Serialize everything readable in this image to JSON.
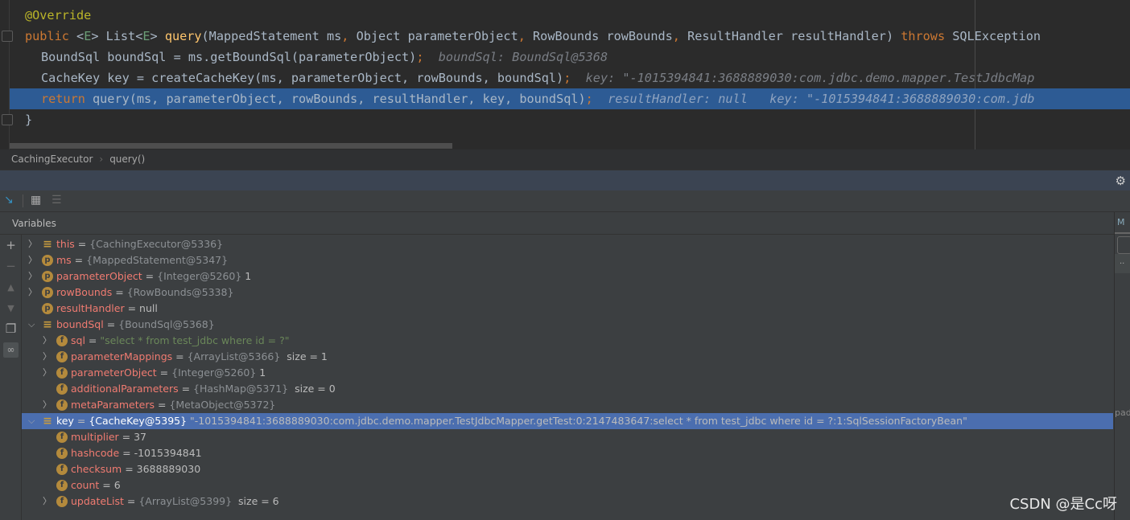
{
  "editor": {
    "lines": [
      {
        "annotation": "@Override"
      },
      {
        "code": [
          "public",
          "<",
          "E",
          "> List<",
          "E",
          "> ",
          "query",
          "(MappedStatement ms",
          ", ",
          "Object parameterObject",
          ", ",
          "RowBounds rowBounds",
          ", ",
          "ResultHandler resultHandler) ",
          "throws",
          " SQLException"
        ]
      },
      {
        "code": "BoundSql boundSql = ms.getBoundSql(parameterObject)",
        "hint": "boundSql: BoundSql@5368"
      },
      {
        "code": "CacheKey key = createCacheKey(ms, parameterObject, rowBounds, boundSql)",
        "hint": "key: \"-1015394841:3688889030:com.jdbc.demo.mapper.TestJdbcMap"
      },
      {
        "keyword": "return",
        "code": " query(ms, parameterObject, rowBounds, resultHandler, key, boundSql)",
        "hint": "resultHandler: null   key: \"-1015394841:3688889030:com.jdb"
      },
      {
        "code": "}"
      }
    ]
  },
  "breadcrumb": [
    "CachingExecutor",
    "query()"
  ],
  "variables": {
    "title": "Variables",
    "rows": [
      {
        "level": 0,
        "expand": ">",
        "icon": "list",
        "name": "this",
        "type": "{CachingExecutor@5336}",
        "value": ""
      },
      {
        "level": 0,
        "expand": ">",
        "icon": "p",
        "name": "ms",
        "type": "{MappedStatement@5347}",
        "value": ""
      },
      {
        "level": 0,
        "expand": ">",
        "icon": "p",
        "name": "parameterObject",
        "type": "{Integer@5260}",
        "value": " 1"
      },
      {
        "level": 0,
        "expand": ">",
        "icon": "p",
        "name": "rowBounds",
        "type": "{RowBounds@5338}",
        "value": ""
      },
      {
        "level": 0,
        "expand": "",
        "icon": "p",
        "name": "resultHandler",
        "type": "",
        "value": "null"
      },
      {
        "level": 0,
        "expand": "v",
        "icon": "list",
        "name": "boundSql",
        "type": "{BoundSql@5368}",
        "value": ""
      },
      {
        "level": 1,
        "expand": ">",
        "icon": "f",
        "name": "sql",
        "type": "",
        "str": "\"select * from test_jdbc where id = ?\""
      },
      {
        "level": 1,
        "expand": ">",
        "icon": "f",
        "name": "parameterMappings",
        "type": "{ArrayList@5366}",
        "value": "  size = 1"
      },
      {
        "level": 1,
        "expand": ">",
        "icon": "f",
        "name": "parameterObject",
        "type": "{Integer@5260}",
        "value": " 1"
      },
      {
        "level": 1,
        "expand": "",
        "icon": "f",
        "name": "additionalParameters",
        "type": "{HashMap@5371}",
        "value": "  size = 0"
      },
      {
        "level": 1,
        "expand": ">",
        "icon": "f",
        "name": "metaParameters",
        "type": "{MetaObject@5372}",
        "value": ""
      },
      {
        "level": 0,
        "expand": "v",
        "icon": "list",
        "name": "key",
        "type": "{CacheKey@5395}",
        "value": " \"-1015394841:3688889030:com.jdbc.demo.mapper.TestJdbcMapper.getTest:0:2147483647:select * from test_jdbc where id = ?:1:SqlSessionFactoryBean\"",
        "selected": true
      },
      {
        "level": 1,
        "expand": "",
        "icon": "f",
        "name": "multiplier",
        "type": "",
        "value": "37"
      },
      {
        "level": 1,
        "expand": "",
        "icon": "f",
        "name": "hashcode",
        "type": "",
        "value": "-1015394841"
      },
      {
        "level": 1,
        "expand": "",
        "icon": "f",
        "name": "checksum",
        "type": "",
        "value": "3688889030"
      },
      {
        "level": 1,
        "expand": "",
        "icon": "f",
        "name": "count",
        "type": "",
        "value": "6"
      },
      {
        "level": 1,
        "expand": ">",
        "icon": "f",
        "name": "updateList",
        "type": "{ArrayList@5399}",
        "value": "  size = 6"
      }
    ]
  },
  "right_panel": {
    "tab": "M",
    "row": "..",
    "partial": "pad"
  },
  "watermark": "CSDN @是Cc呀",
  "colors": {
    "selection": "#4b6eaf",
    "line_highlight": "#2d5b94",
    "name": "#f07b71"
  }
}
